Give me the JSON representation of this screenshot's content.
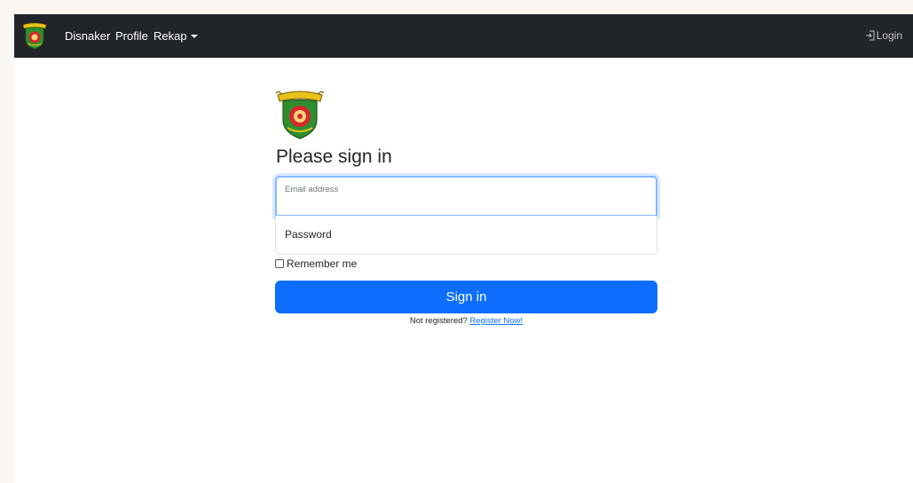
{
  "navbar": {
    "brand": "Disnaker",
    "profile": "Profile",
    "rekap": "Rekap",
    "login": "Login",
    "background": "#212529",
    "logo_icon": "crest-emblem-icon",
    "login_icon": "box-arrow-in-right-icon"
  },
  "signin": {
    "title": "Please sign in",
    "email_label": "Email address",
    "email_value": "",
    "password_label": "Password",
    "remember_label": "Remember me",
    "remember_checked": false,
    "button_label": "Sign in",
    "not_registered": "Not registered?",
    "register_link": "Register Now!",
    "accent": "#0d6efd",
    "logo_icon": "crest-emblem-icon"
  }
}
